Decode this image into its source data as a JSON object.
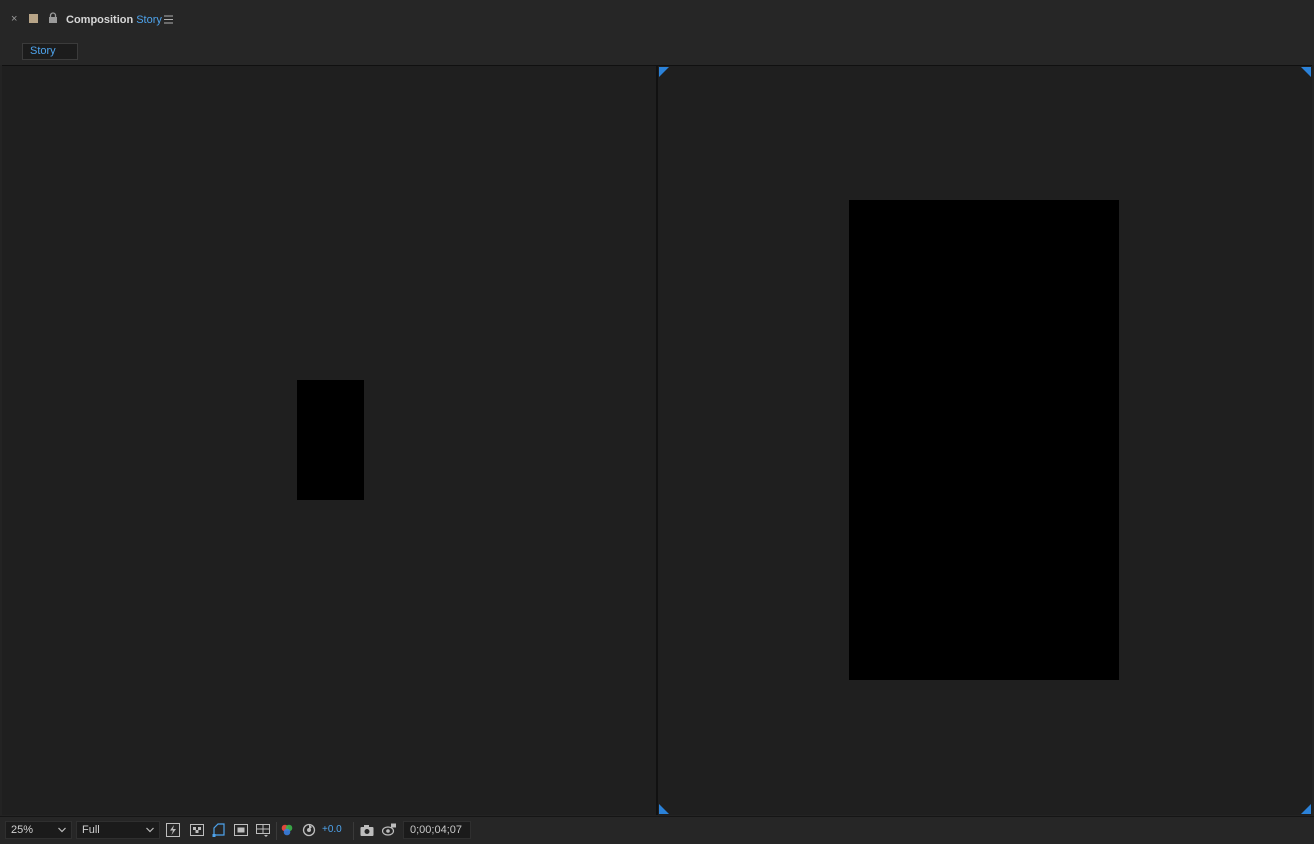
{
  "panel": {
    "close_glyph": "×",
    "label_color": "#b7a487",
    "title_prefix": "Composition",
    "comp_name": "Story",
    "menu_icon": "hamburger-icon"
  },
  "breadcrumb": {
    "label": "Story"
  },
  "viewer": {
    "accent_color": "#2b82d9",
    "frame_color": "#000000"
  },
  "toolbar": {
    "zoom_value": "25%",
    "resolution_value": "Full",
    "exposure_value": "+0.0",
    "timecode": "0;00;04;07",
    "icons": [
      "fast-previews-icon",
      "transparency-grid-icon",
      "mask-path-icon",
      "region-of-interest-icon",
      "grid-guides-icon",
      "channel-rgb-icon",
      "reset-exposure-icon",
      "snapshot-camera-icon",
      "show-snapshot-icon"
    ]
  }
}
